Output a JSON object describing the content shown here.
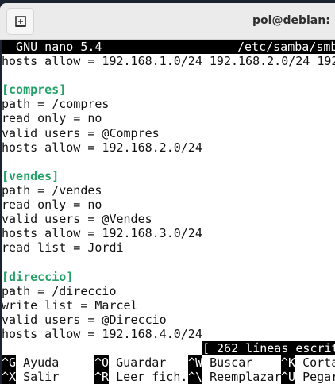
{
  "window": {
    "title": "pol@debian: ~"
  },
  "nano": {
    "version_label": "  GNU nano 5.4",
    "filename": "/etc/samba/smb",
    "lines": [
      {
        "text": "hosts allow = 192.168.1.0/24 192.168.2.0/24 192",
        "section": false
      },
      {
        "text": "",
        "section": false
      },
      {
        "text": "[compres]",
        "section": true
      },
      {
        "text": "path = /compres",
        "section": false
      },
      {
        "text": "read only = no",
        "section": false
      },
      {
        "text": "valid users = @Compres",
        "section": false
      },
      {
        "text": "hosts allow = 192.168.2.0/24",
        "section": false
      },
      {
        "text": "",
        "section": false
      },
      {
        "text": "[vendes]",
        "section": true
      },
      {
        "text": "path = /vendes",
        "section": false
      },
      {
        "text": "read only = no",
        "section": false
      },
      {
        "text": "valid users = @Vendes",
        "section": false
      },
      {
        "text": "hosts allow = 192.168.3.0/24",
        "section": false
      },
      {
        "text": "read list = Jordi",
        "section": false
      },
      {
        "text": "",
        "section": false
      },
      {
        "text": "[direccio]",
        "section": true
      },
      {
        "text": "path = /direccio",
        "section": false
      },
      {
        "text": "write list = Marcel",
        "section": false
      },
      {
        "text": "valid users = @Direccio",
        "section": false
      },
      {
        "text": "hosts allow = 192.168.4.0/24",
        "section": false
      }
    ],
    "status": "[ 262 líneas escrit",
    "shortcuts": [
      [
        {
          "key": "^G",
          "label": " Ayuda"
        },
        {
          "key": "^O",
          "label": " Guardar"
        },
        {
          "key": "^W",
          "label": " Buscar"
        },
        {
          "key": "^K",
          "label": " Corta"
        }
      ],
      [
        {
          "key": "^X",
          "label": " Salir"
        },
        {
          "key": "^R",
          "label": " Leer fich."
        },
        {
          "key": "^\\",
          "label": " Reemplazar"
        },
        {
          "key": "^U",
          "label": " Pegar"
        }
      ]
    ]
  }
}
